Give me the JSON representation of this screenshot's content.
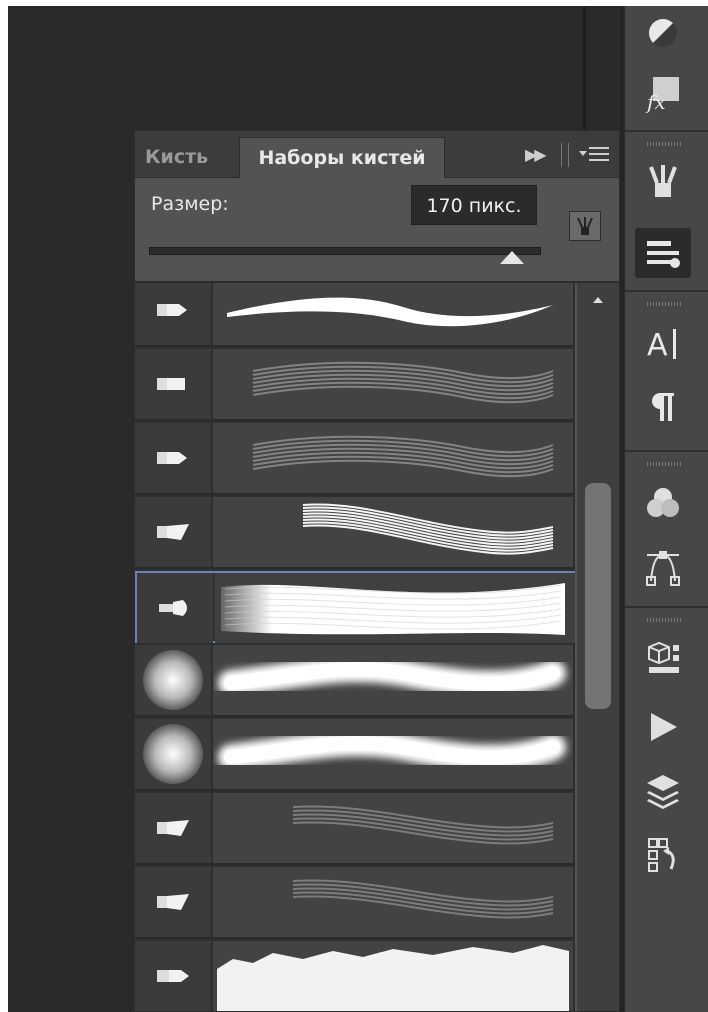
{
  "panel": {
    "tabs": [
      {
        "label": "Кисть",
        "active": false
      },
      {
        "label": "Наборы кистей",
        "active": true
      }
    ],
    "size_label": "Размер:",
    "size_value": "170 пикс.",
    "slider_level": 0.93
  },
  "brushes": [
    {
      "tip": "round-tip-icon",
      "stroke": "solid-taper"
    },
    {
      "tip": "flat-tip-icon",
      "stroke": "dry-bristle"
    },
    {
      "tip": "round-tip-icon",
      "stroke": "dry-bristle"
    },
    {
      "tip": "fan-tip-icon",
      "stroke": "bristle-streak"
    },
    {
      "tip": "round-fan-tip-icon",
      "stroke": "bristle-wide",
      "selected": true
    },
    {
      "tip": "soft-round-icon",
      "stroke": "soft-glow"
    },
    {
      "tip": "soft-round-icon",
      "stroke": "soft-glow"
    },
    {
      "tip": "fan-tip-icon",
      "stroke": "faint-bristle"
    },
    {
      "tip": "fan-tip-icon",
      "stroke": "faint-bristle"
    },
    {
      "tip": "pointed-tip-icon",
      "stroke": "rough-texture"
    }
  ],
  "dock_icons": [
    "adjustments-icon",
    "fx-icon",
    "brush-icon",
    "brush-presets-icon",
    "character-icon",
    "paragraph-icon",
    "channels-icon",
    "paths-icon",
    "3d-icon",
    "actions-icon",
    "layers-icon",
    "history-icon"
  ]
}
